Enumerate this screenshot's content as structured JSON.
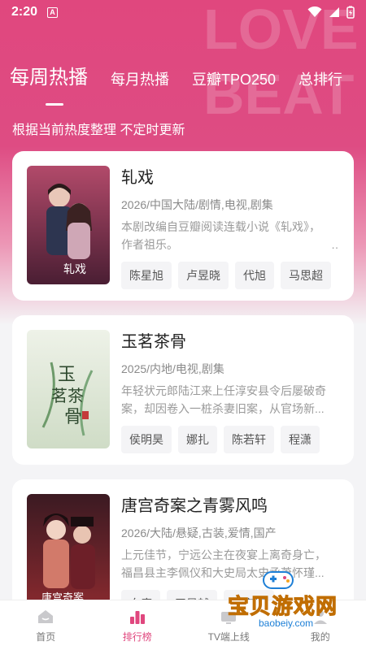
{
  "status_bar": {
    "time": "2:20",
    "app_badge": "A"
  },
  "tabs": [
    {
      "label": "每周热播",
      "active": true
    },
    {
      "label": "每月热播"
    },
    {
      "label": "豆瓣TPO250"
    },
    {
      "label": "总排行"
    }
  ],
  "subtitle": "根据当前热度整理 不定时更新",
  "cards": [
    {
      "title": "轧戏",
      "meta": "2026/中国大陆/剧情,电视,剧集",
      "desc": "本剧改编自豆瓣阅读连载小说《轧戏》，作者祖乐。",
      "tags": [
        "陈星旭",
        "卢昱晓",
        "代旭",
        "马思超"
      ]
    },
    {
      "title": "玉茗茶骨",
      "meta": "2025/内地/电视,剧集",
      "desc": "年轻状元郎陆江来上任淳安县令后屡破奇案，却因卷入一桩杀妻旧案，从官场新...",
      "tags": [
        "侯明昊",
        "娜扎",
        "陈若轩",
        "程潇"
      ]
    },
    {
      "title": "唐宫奇案之青雾风鸣",
      "meta": "2026/大陆/悬疑,古装,爱情,国产",
      "desc": "上元佳节，宁远公主在夜宴上离奇身亡，福昌县主李佩仪和大史局太史丞萧怀瑾...",
      "tags": [
        "白鹿",
        "王星越",
        "姚安娜"
      ]
    }
  ],
  "bottom_nav": [
    {
      "label": "首页",
      "icon": "home-icon"
    },
    {
      "label": "排行榜",
      "icon": "ranking-icon",
      "active": true
    },
    {
      "label": "TV端上线",
      "icon": "tv-icon"
    },
    {
      "label": "我的",
      "icon": "profile-icon"
    }
  ],
  "watermark": {
    "text": "宝贝游戏网",
    "url": "baobeiy.com"
  },
  "colors": {
    "accent": "#e0477e",
    "watermark": "#f5a623"
  }
}
